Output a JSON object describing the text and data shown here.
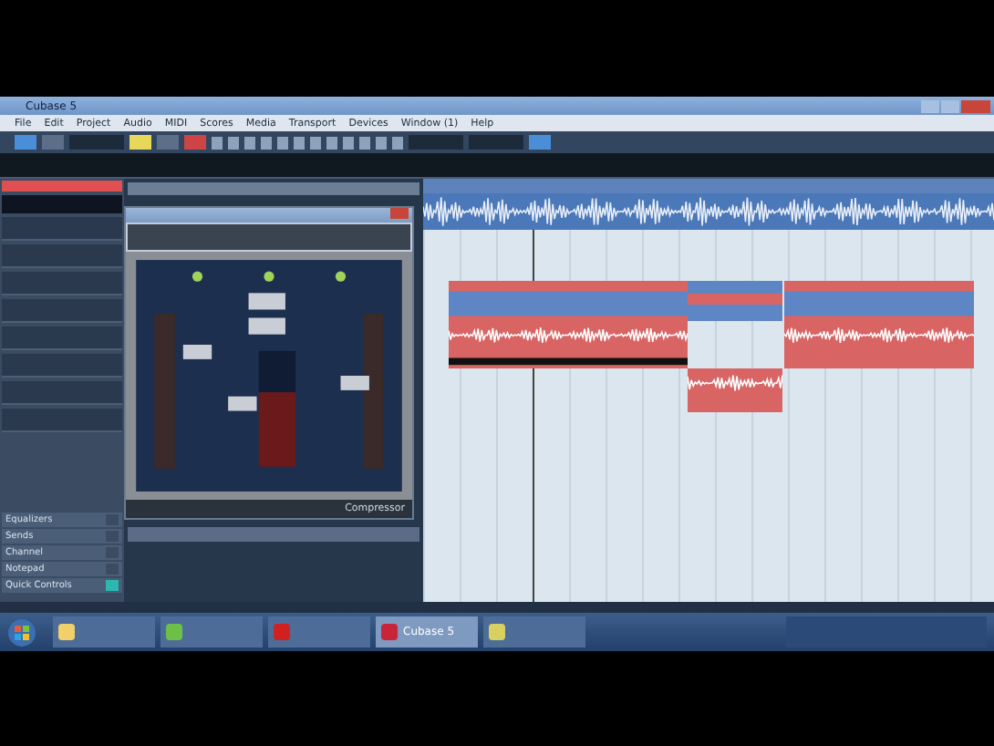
{
  "window": {
    "title": "Cubase 5"
  },
  "menu": [
    "File",
    "Edit",
    "Project",
    "Audio",
    "MIDI",
    "Scores",
    "Media",
    "Transport",
    "Devices",
    "Window (1)",
    "Help"
  ],
  "inspector": {
    "sections": [
      {
        "label": "Equalizers",
        "on": false
      },
      {
        "label": "Sends",
        "on": false
      },
      {
        "label": "Channel",
        "on": false
      },
      {
        "label": "Notepad",
        "on": false
      },
      {
        "label": "Quick Controls",
        "on": true
      }
    ]
  },
  "plugin": {
    "title": "Compressor"
  },
  "taskbar": {
    "active": "Cubase 5"
  }
}
